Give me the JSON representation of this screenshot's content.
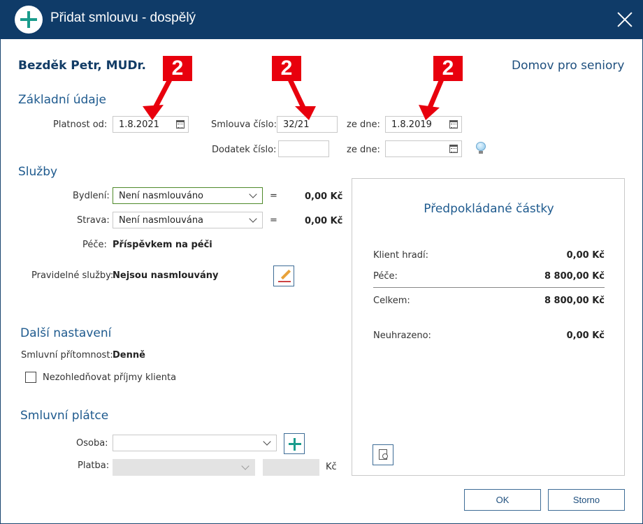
{
  "window": {
    "title": "Přidat smlouvu - dospělý"
  },
  "header": {
    "person": "Bezděk Petr, MUDr.",
    "organization": "Domov pro seniory"
  },
  "basic": {
    "section_title": "Základní údaje",
    "valid_from_label": "Platnost od:",
    "valid_from_value": "1.8.2021",
    "contract_no_label": "Smlouva číslo:",
    "contract_no_value": "32/21",
    "date_label": "ze dne:",
    "date_value": "1.8.2019",
    "addendum_label": "Dodatek číslo:",
    "addendum_value": "",
    "addendum_date_label": "ze dne:",
    "addendum_date_value": ""
  },
  "services": {
    "section_title": "Služby",
    "housing_label": "Bydlení:",
    "housing_value": "Není nasmlouváno",
    "housing_amount": "0,00 Kč",
    "food_label": "Strava:",
    "food_value": "Není nasmlouvána",
    "food_amount": "0,00 Kč",
    "equals": "=",
    "care_label": "Péče:",
    "care_value": "Příspěvkem na péči",
    "regular_label": "Pravidelné služby:",
    "regular_value": "Nejsou nasmlouvány"
  },
  "other": {
    "section_title": "Další nastavení",
    "presence_label": "Smluvní přítomnost:",
    "presence_value": "Denně",
    "ignore_income_label": "Nezohledňovat příjmy klienta",
    "ignore_income_checked": false
  },
  "payer": {
    "section_title": "Smluvní plátce",
    "person_label": "Osoba:",
    "person_value": "",
    "payment_label": "Platba:",
    "payment_value": "",
    "amount_value": "",
    "currency": "Kč"
  },
  "estimate": {
    "title": "Předpokládané částky",
    "rows": [
      {
        "label": "Klient hradí:",
        "value": "0,00 Kč"
      },
      {
        "label": "Péče:",
        "value": "8 800,00 Kč"
      },
      {
        "label": "Celkem:",
        "value": "8 800,00 Kč"
      },
      {
        "label": "Neuhrazeno:",
        "value": "0,00 Kč"
      }
    ]
  },
  "buttons": {
    "ok": "OK",
    "cancel": "Storno"
  },
  "annotations": {
    "badges": [
      "2",
      "2",
      "2"
    ],
    "color": "#e8000d"
  },
  "colors": {
    "titlebar": "#0f3b68",
    "accent_green": "#1a9c8c",
    "section_blue": "#1e5a8e"
  },
  "icons": [
    "add-icon",
    "close-icon",
    "calendar-icon",
    "lightbulb-icon",
    "chevron-down-icon",
    "pencil-icon",
    "preview-icon"
  ]
}
